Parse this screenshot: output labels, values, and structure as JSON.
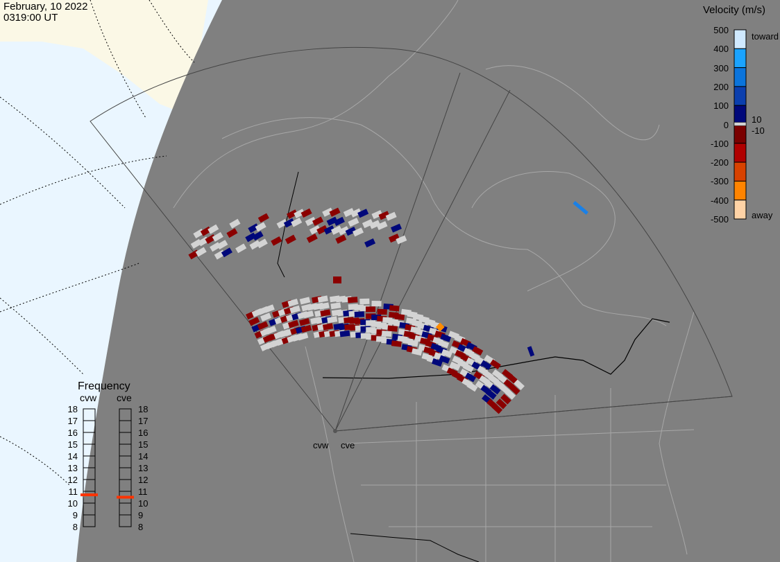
{
  "header": {
    "date": "February, 10 2022",
    "time": "0319:00 UT"
  },
  "colorbar": {
    "title": "Velocity (m/s)",
    "ticks": [
      "500",
      "400",
      "300",
      "200",
      "100",
      "0",
      "-100",
      "-200",
      "-300",
      "-400",
      "-500"
    ],
    "toward_label": "toward",
    "away_label": "away",
    "pos_threshold": "10",
    "neg_threshold": "-10",
    "colors": [
      "#cfe9ff",
      "#1aa3ff",
      "#0a74dc",
      "#0b3fae",
      "#00087a",
      "#7a0000",
      "#b00000",
      "#d84200",
      "#ff8400",
      "#ffd3a6"
    ]
  },
  "frequency": {
    "title": "Frequency",
    "radars": [
      {
        "name": "cvw",
        "value_mhz": 10.7
      },
      {
        "name": "cve",
        "value_mhz": 10.5
      }
    ],
    "ticks": [
      "18",
      "17",
      "16",
      "15",
      "14",
      "13",
      "12",
      "11",
      "10",
      "9",
      "8"
    ],
    "marker_color": "#ff3300"
  },
  "radars": {
    "west": "cvw",
    "east": "cve"
  },
  "colors": {
    "ocean": "#eaf6ff",
    "land_day": "#fbf8e6",
    "night": "#808080",
    "scatter_ground": "#d3d3d3"
  }
}
